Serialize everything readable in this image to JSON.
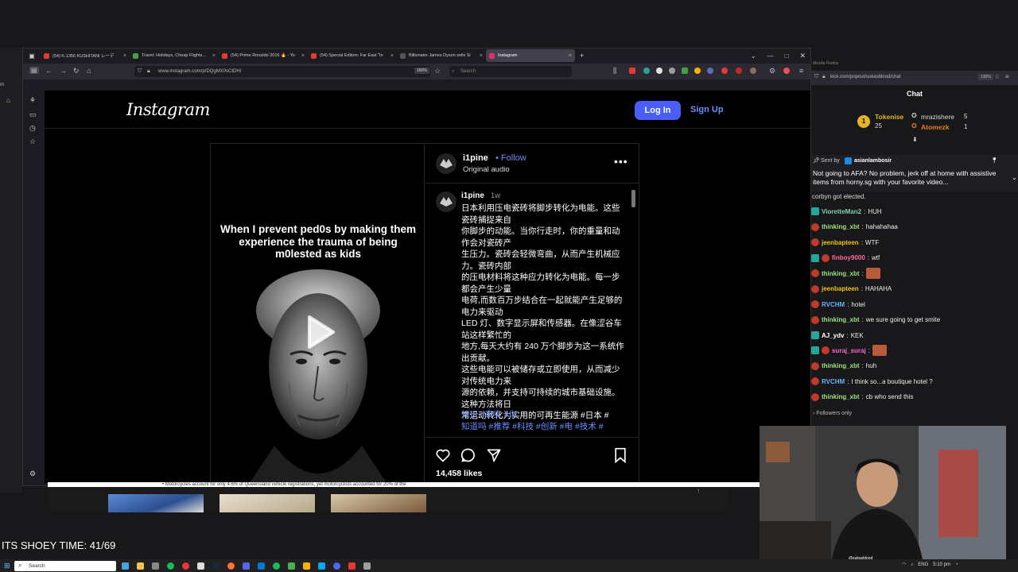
{
  "browser": {
    "tabs": [
      {
        "label": "(54) K-1356 KUSHITANI レーデ",
        "color": "#e53935",
        "active": false
      },
      {
        "label": "Travel: Holidays, Cheap Flights...",
        "color": "#43a047",
        "active": false
      },
      {
        "label": "(54) Prime Ronaldo 2016 🔥 - Yo",
        "color": "#e53935",
        "active": false
      },
      {
        "label": "(54) Special Edition: Far East \"In",
        "color": "#e53935",
        "active": false
      },
      {
        "label": "Billionaire James Dyson sells Si",
        "color": "#555555",
        "active": false
      },
      {
        "label": "Instagram",
        "color": "#e1306c",
        "active": true
      }
    ],
    "url": "www.instagram.com/p/DQgMX0sCtDH/",
    "zoom": "160%",
    "search_placeholder": "Search"
  },
  "instagram": {
    "logo": "Instagram",
    "login_label": "Log In",
    "signup_label": "Sign Up",
    "post": {
      "media_caption": "When I prevent ped0s by making them experience the trauma of being m0lested as kids",
      "author": "i1pine",
      "follow_label": "• Follow",
      "audio": "Original audio",
      "more": "•••",
      "comment_user": "i1pine",
      "comment_time": "1w",
      "comment_body": "日本利用压电瓷砖将脚步转化为电能。这些瓷砖捕捉来自\n你脚步的动能。当你行走时，你的重量和动作会对瓷砖产\n生压力。瓷砖会轻微弯曲，从而产生机械应力。瓷砖内部\n的压电材料将这种应力转化为电能。每一步都会产生少量\n电荷,而数百万步结合在一起就能产生足够的电力来驱动\nLED 灯、数字显示屏和传感器。在像涩谷车站这样繁忙的\n地方,每天大约有 240 万个脚步为这一系统作出贡献。\n这些电能可以被储存或立即使用，从而减少对传统电力来\n源的依赖，并支持可持续的城市基础设施。这种方法将日\n常运动转化为实用的可再生能源 #日本 #",
      "comment_tags": "知识 #事实 #你\n知道吗 #推荐 #科技 #创新 #电 #技术 #",
      "likes": "14,458 likes"
    }
  },
  "below_text": "• Motorcycles account for only 4.6% of Queensland vehicle registrations, yet motorcyclists accounted for 20% of the",
  "overlay": {
    "shoey": "ITS SHOEY TIME: 41/69"
  },
  "taskbar": {
    "search_placeholder": "Search",
    "lang": "ENG",
    "time": "5:10 pm"
  },
  "chat": {
    "window_title": "Mozilla Firefox",
    "url": "kick.com/popout/sukasblood/chat",
    "zoom": "130%",
    "title": "Chat",
    "leaderboard": [
      {
        "rank": "1",
        "name": "Tokenise",
        "count": "25"
      },
      {
        "rank": "",
        "name": "mrazishere",
        "count": "5"
      },
      {
        "rank": "",
        "name": "Atomezk",
        "count": "1"
      }
    ],
    "pinned_sender_prefix": "Sent by",
    "pinned_sender": "asianlambosir",
    "pinned_text": "Not going to AFA? No problem, jerk off at home with assistive items from horny.sg with your favorite video...",
    "partial_line": "corbyn got elected.",
    "messages": [
      {
        "user": "VioretteMan2",
        "text": "HUH",
        "color": "#7fd1ae"
      },
      {
        "user": "thinking_xbt",
        "text": "hahahahaa",
        "color": "#9ee37d"
      },
      {
        "user": "jeenbapteen",
        "text": "WTF",
        "color": "#f1c40f"
      },
      {
        "user": "finboy9000",
        "text": "wtf",
        "color": "#ff6b9a"
      },
      {
        "user": "thinking_xbt",
        "text": "",
        "color": "#9ee37d",
        "emote": true
      },
      {
        "user": "jeenbapteen",
        "text": "HAHAHA",
        "color": "#f1c40f"
      },
      {
        "user": "RVCHM",
        "text": "hotel",
        "color": "#66b3ff"
      },
      {
        "user": "thinking_xbt",
        "text": "we sure going to get smite",
        "color": "#9ee37d"
      },
      {
        "user": "AJ_ydv",
        "text": "KEK",
        "color": "#ffffff"
      },
      {
        "user": "suraj_suraj",
        "text": "",
        "color": "#ff66cc",
        "emote": true
      },
      {
        "user": "thinking_xbt",
        "text": "huh",
        "color": "#9ee37d"
      },
      {
        "user": "RVCHM",
        "text": "I think so...a boutique hotel ?",
        "color": "#66b3ff"
      },
      {
        "user": "thinking_xbt",
        "text": "cb who send this",
        "color": "#9ee37d"
      }
    ],
    "followers_only": "Followers only"
  },
  "webcam": {
    "handle": "@sukasblood"
  }
}
